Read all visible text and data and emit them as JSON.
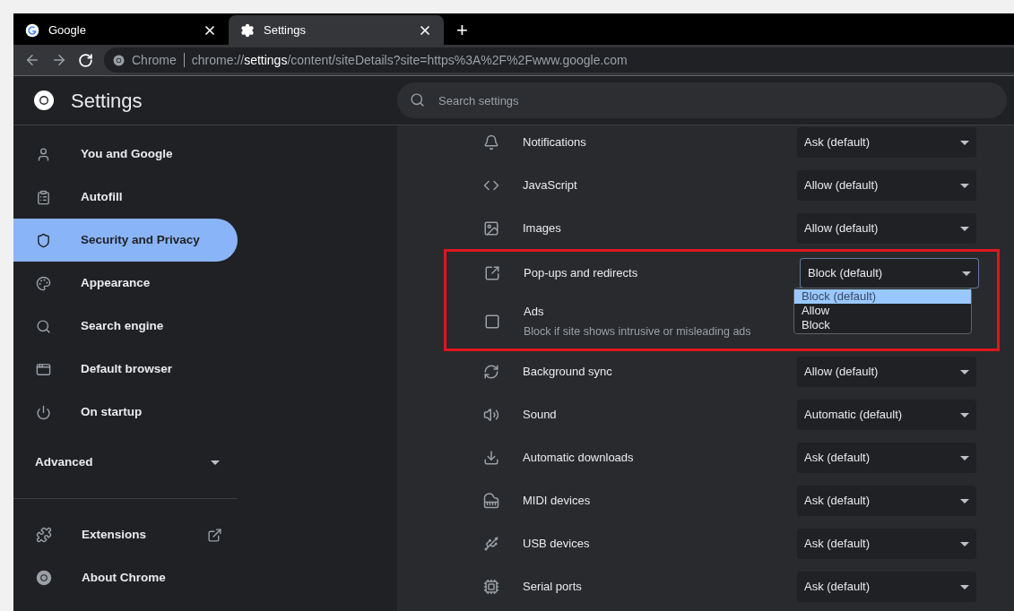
{
  "tabs": [
    {
      "title": "Google",
      "selected": false
    },
    {
      "title": "Settings",
      "selected": true
    }
  ],
  "new_tab": "+",
  "address_bar": {
    "origin_label": "Chrome",
    "url_scheme": "chrome://",
    "url_host": "settings",
    "url_path": "/content/siteDetails?site=https%3A%2F%2Fwww.google.com"
  },
  "header": {
    "title": "Settings",
    "search": {
      "placeholder": "Search settings"
    }
  },
  "sidebar": {
    "items": [
      {
        "label": "You and Google",
        "selected": false
      },
      {
        "label": "Autofill",
        "selected": false
      },
      {
        "label": "Security and Privacy",
        "selected": true
      },
      {
        "label": "Appearance",
        "selected": false
      },
      {
        "label": "Search engine",
        "selected": false
      },
      {
        "label": "Default browser",
        "selected": false
      },
      {
        "label": "On startup",
        "selected": false
      }
    ],
    "advanced": {
      "label": "Advanced",
      "expanded": false
    },
    "footer_items": [
      {
        "label": "Extensions"
      },
      {
        "label": "About Chrome"
      }
    ]
  },
  "permissions": [
    {
      "kind": "setting",
      "label": "Notifications",
      "value": "Ask (default)"
    },
    {
      "kind": "setting",
      "label": "JavaScript",
      "value": "Allow (default)"
    },
    {
      "kind": "setting",
      "label": "Images",
      "value": "Allow (default)"
    },
    {
      "kind": "highlight",
      "items": [
        {
          "label": "Pop-ups and redirects",
          "value": "Block (default)",
          "menu": {
            "options": [
              {
                "label": "Block (default)",
                "selected": true
              },
              {
                "label": "Allow",
                "selected": false
              },
              {
                "label": "Block",
                "selected": false
              }
            ]
          }
        },
        {
          "label": "Ads",
          "description": "Block if site shows intrusive or misleading ads"
        }
      ]
    },
    {
      "kind": "setting",
      "label": "Background sync",
      "value": "Allow (default)"
    },
    {
      "kind": "setting",
      "label": "Sound",
      "value": "Automatic (default)"
    },
    {
      "kind": "setting",
      "label": "Automatic downloads",
      "value": "Ask (default)"
    },
    {
      "kind": "setting",
      "label": "MIDI devices",
      "value": "Ask (default)"
    },
    {
      "kind": "setting",
      "label": "USB devices",
      "value": "Ask (default)"
    },
    {
      "kind": "setting",
      "label": "Serial ports",
      "value": "Ask (default)"
    }
  ]
}
